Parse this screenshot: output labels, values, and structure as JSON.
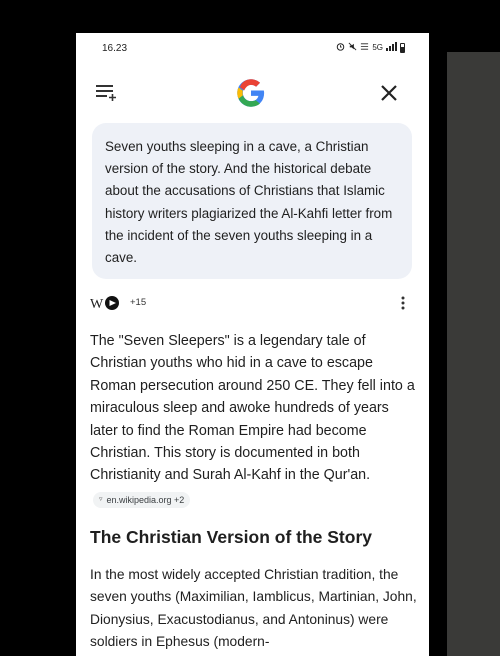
{
  "status_bar": {
    "time": "16.23",
    "network": "5G",
    "icons": [
      "alarm-icon",
      "mute-icon",
      "volte-icon",
      "signal-icon",
      "battery-icon"
    ]
  },
  "toolbar": {
    "menu_icon": "menu-icon",
    "logo": "G",
    "close_icon": "close-icon"
  },
  "query": {
    "text": "Seven youths sleeping in a cave, a Christian version of the story. And the historical debate about the accusations of Christians that Islamic history writers plagiarized the Al-Kahfi letter from the incident of the seven youths sleeping in a cave."
  },
  "sources": {
    "logo_text": "W",
    "count_label": "+15"
  },
  "answer": {
    "paragraph": "The \"Seven Sleepers\" is a legendary tale of Christian youths who hid in a cave to escape Roman persecution around 250 CE. They fell into a miraculous sleep and awoke hundreds of years later to find the Roman Empire had become Christian. This story is documented in both Christianity and Surah Al-Kahf in the Qur'an.",
    "citation_label": "en.wikipedia.org +2"
  },
  "section": {
    "heading": "The Christian Version of the Story",
    "body": "In the most widely accepted Christian tradition, the seven youths (Maximilian, Iamblicus, Martinian, John, Dionysius, Exacustodianus, and Antoninus) were soldiers in Ephesus (modern-"
  },
  "colors": {
    "bubble_bg": "#eef1f7",
    "google_blue": "#4285F4",
    "google_red": "#EA4335",
    "google_yellow": "#FBBC05",
    "google_green": "#34A853"
  }
}
